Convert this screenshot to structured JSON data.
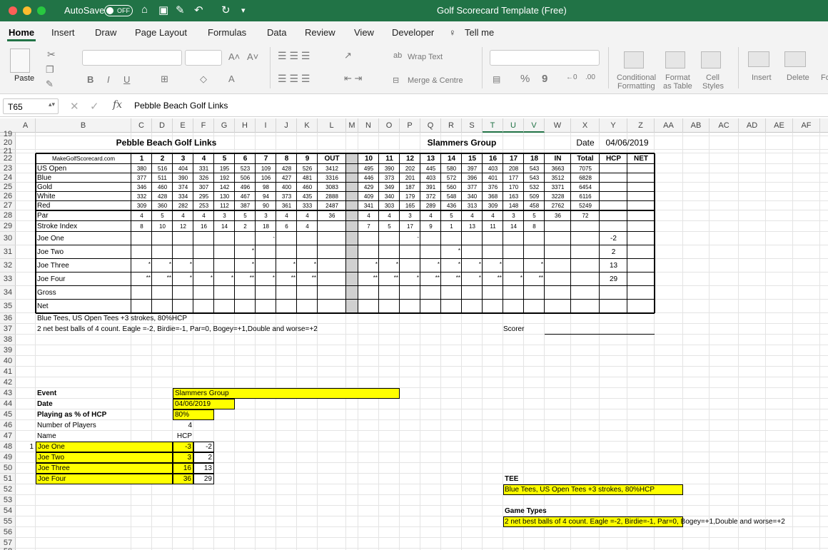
{
  "window": {
    "autosave_label": "AutoSave",
    "autosave_state": "OFF",
    "title": "Golf Scorecard Template (Free)"
  },
  "ribbon_tabs": [
    "Home",
    "Insert",
    "Draw",
    "Page Layout",
    "Formulas",
    "Data",
    "Review",
    "View",
    "Developer",
    "Tell me"
  ],
  "ribbon": {
    "paste": "Paste",
    "wrap_text": "Wrap Text",
    "merge_centre": "Merge & Centre",
    "percent": "%",
    "comma": "9",
    "cond1": "Conditional",
    "cond2": "Formatting",
    "fmt1": "Format",
    "fmt2": "as Table",
    "cell1": "Cell",
    "cell2": "Styles",
    "insert": "Insert",
    "delete": "Delete",
    "format": "Fo",
    "font_bold": "B",
    "font_italic": "I",
    "font_underline": "U"
  },
  "formula_bar": {
    "name_box": "T65",
    "fx": "fx",
    "value": "Pebble Beach Golf Links"
  },
  "columns": [
    "A",
    "B",
    "C",
    "D",
    "E",
    "F",
    "G",
    "H",
    "I",
    "J",
    "K",
    "L",
    "M",
    "N",
    "O",
    "P",
    "Q",
    "R",
    "S",
    "T",
    "U",
    "V",
    "W",
    "X",
    "Y",
    "Z",
    "AA",
    "AB",
    "AC",
    "AD",
    "AE",
    "AF",
    "A"
  ],
  "rows": [
    "19",
    "20",
    "21",
    "22",
    "23",
    "24",
    "25",
    "26",
    "27",
    "28",
    "29",
    "30",
    "31",
    "32",
    "33",
    "34",
    "35",
    "36",
    "37",
    "38",
    "39",
    "40",
    "41",
    "42",
    "43",
    "44",
    "45",
    "46",
    "47",
    "48",
    "49",
    "50",
    "51",
    "52",
    "53",
    "54",
    "55",
    "56",
    "57",
    "58"
  ],
  "scorecard": {
    "course": "Pebble Beach Golf Links",
    "group": "Slammers Group",
    "date_label": "Date",
    "date": "04/06/2019",
    "site": "MakeGolfScorecard.com",
    "holes_front": [
      "1",
      "2",
      "3",
      "4",
      "5",
      "6",
      "7",
      "8",
      "9"
    ],
    "out": "OUT",
    "holes_back": [
      "10",
      "11",
      "12",
      "13",
      "14",
      "15",
      "16",
      "17",
      "18"
    ],
    "in": "IN",
    "total": "Total",
    "hcp": "HCP",
    "net": "NET",
    "tees": [
      {
        "name": "US Open",
        "f": [
          "380",
          "516",
          "404",
          "331",
          "195",
          "523",
          "109",
          "428",
          "526"
        ],
        "out": "3412",
        "b": [
          "495",
          "390",
          "202",
          "445",
          "580",
          "397",
          "403",
          "208",
          "543"
        ],
        "in": "3663",
        "total": "7075"
      },
      {
        "name": "Blue",
        "f": [
          "377",
          "511",
          "390",
          "326",
          "192",
          "506",
          "106",
          "427",
          "481"
        ],
        "out": "3316",
        "b": [
          "446",
          "373",
          "201",
          "403",
          "572",
          "396",
          "401",
          "177",
          "543"
        ],
        "in": "3512",
        "total": "6828"
      },
      {
        "name": "Gold",
        "f": [
          "346",
          "460",
          "374",
          "307",
          "142",
          "496",
          "98",
          "400",
          "460"
        ],
        "out": "3083",
        "b": [
          "429",
          "349",
          "187",
          "391",
          "560",
          "377",
          "376",
          "170",
          "532"
        ],
        "in": "3371",
        "total": "6454"
      },
      {
        "name": "White",
        "f": [
          "332",
          "428",
          "334",
          "295",
          "130",
          "467",
          "94",
          "373",
          "435"
        ],
        "out": "2888",
        "b": [
          "409",
          "340",
          "179",
          "372",
          "548",
          "340",
          "368",
          "163",
          "509"
        ],
        "in": "3228",
        "total": "6116"
      },
      {
        "name": "Red",
        "f": [
          "309",
          "360",
          "282",
          "253",
          "112",
          "387",
          "90",
          "361",
          "333"
        ],
        "out": "2487",
        "b": [
          "341",
          "303",
          "165",
          "289",
          "436",
          "313",
          "309",
          "148",
          "458"
        ],
        "in": "2762",
        "total": "5249"
      }
    ],
    "par": {
      "name": "Par",
      "f": [
        "4",
        "5",
        "4",
        "4",
        "3",
        "5",
        "3",
        "4",
        "4"
      ],
      "out": "36",
      "b": [
        "4",
        "4",
        "3",
        "4",
        "5",
        "4",
        "4",
        "3",
        "5"
      ],
      "in": "36",
      "total": "72"
    },
    "stroke": {
      "name": "Stroke Index",
      "f": [
        "8",
        "10",
        "12",
        "16",
        "14",
        "2",
        "18",
        "6",
        "4"
      ],
      "b": [
        "7",
        "5",
        "17",
        "9",
        "1",
        "13",
        "11",
        "14",
        "8"
      ]
    },
    "players": [
      {
        "name": "Joe One",
        "f": [
          "",
          "",
          "",
          "",
          "",
          "",
          "-",
          "",
          ""
        ],
        "b": [
          "",
          "",
          "-",
          "",
          "",
          "",
          "",
          "",
          ""
        ],
        "hcp": "-2"
      },
      {
        "name": "Joe Two",
        "f": [
          "",
          "",
          "",
          "",
          "",
          "*",
          "",
          "",
          ""
        ],
        "b": [
          "",
          "",
          "",
          "",
          "*",
          "",
          "",
          "",
          ""
        ],
        "hcp": "2"
      },
      {
        "name": "Joe Three",
        "f": [
          "*",
          "*",
          "*",
          "",
          "",
          "*",
          "",
          "*",
          "*"
        ],
        "b": [
          "*",
          "*",
          "",
          "*",
          "*",
          "*",
          "*",
          "",
          "*"
        ],
        "hcp": "13"
      },
      {
        "name": "Joe Four",
        "f": [
          "**",
          "**",
          "*",
          "*",
          "*",
          "**",
          "*",
          "**",
          "**"
        ],
        "b": [
          "**",
          "**",
          "*",
          "**",
          "**",
          "*",
          "**",
          "*",
          "**"
        ],
        "hcp": "29"
      }
    ],
    "gross": "Gross",
    "net_row": "Net",
    "note1": "Blue Tees, US Open Tees +3 strokes, 80%HCP",
    "note2": "2 net best balls of 4 count. Eagle =-2, Birdie=-1, Par=0, Bogey=+1,Double and worse=+2",
    "scorer": "Scorer"
  },
  "setup": {
    "event_label": "Event",
    "event": "Slammers Group",
    "date_label": "Date",
    "date": "04/06/2019",
    "pct_label": "Playing as % of HCP",
    "pct": "80%",
    "num_label": "Number of Players",
    "num": "4",
    "name_label": "Name",
    "hcp_label": "HCP",
    "index": "1",
    "players": [
      {
        "name": "Joe One",
        "hcp": "-3",
        "calc": "-2"
      },
      {
        "name": "Joe Two",
        "hcp": "3",
        "calc": "2"
      },
      {
        "name": "Joe Three",
        "hcp": "16",
        "calc": "13"
      },
      {
        "name": "Joe Four",
        "hcp": "36",
        "calc": "29"
      }
    ],
    "tee_label": "TEE",
    "tee": "Blue Tees, US Open Tees +3 strokes, 80%HCP",
    "game_label": "Game Types",
    "game": "2 net best balls of 4 count. Eagle =-2, Birdie=-1, Par=0, Bogey=+1,Double and worse=+2"
  }
}
